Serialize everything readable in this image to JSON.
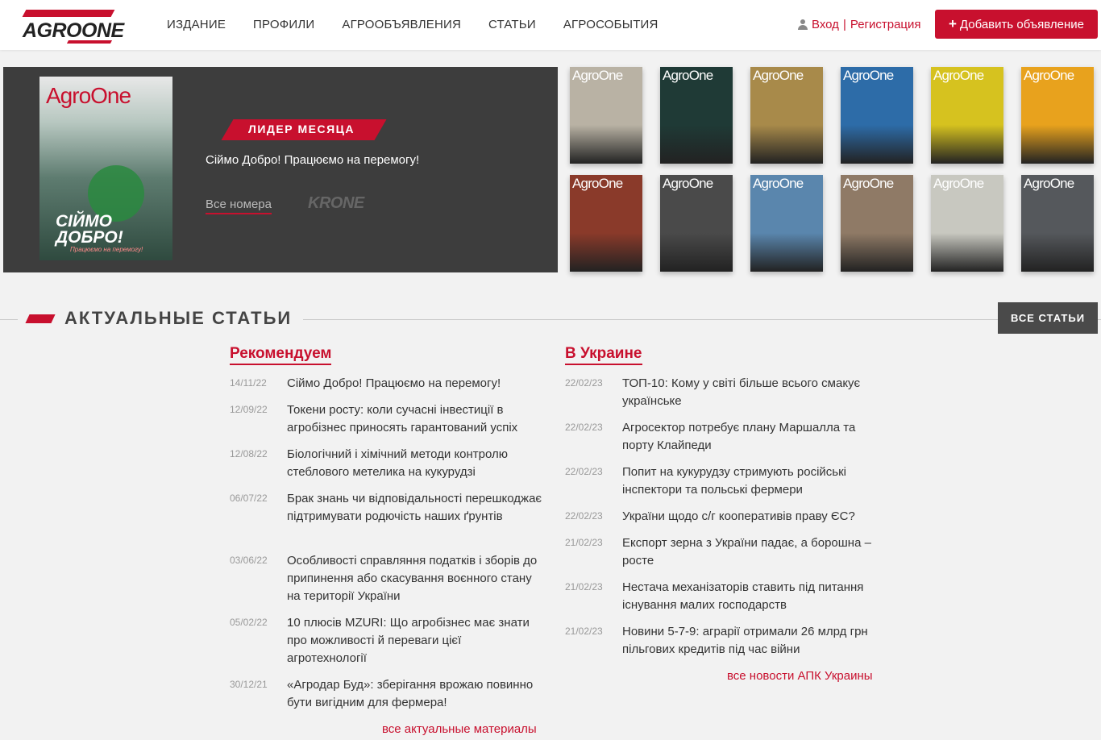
{
  "header": {
    "logo_text_agro": "AGRO",
    "logo_text_one": "ONE",
    "nav": [
      "ИЗДАНИЕ",
      "ПРОФИЛИ",
      "АГРООБЪЯВЛЕНИЯ",
      "СТАТЬИ",
      "АГРОСОБЫТИЯ"
    ],
    "login": "Вход",
    "separator": "|",
    "register": "Регистрация",
    "add_button": "Добавить объявление",
    "add_button_icon": "+"
  },
  "hero": {
    "cover_title": "AgroOne",
    "cover_big": "СІЙМО ДОБРО!",
    "cover_sub": "Працюємо на перемогу!",
    "badge": "ЛИДЕР МЕСЯЦА",
    "subtitle": "Сіймо Добро! Працюємо на перемогу!",
    "all_issues": "Все номера",
    "brand": "KRONE"
  },
  "covers": {
    "title": "AgroOne",
    "colors": [
      "#b9b2a4",
      "#1f3a36",
      "#a88a4a",
      "#2d6ca8",
      "#d6c21f",
      "#e8a21d",
      "#8a3a2a",
      "#4a4a4a",
      "#5a86ad",
      "#8f7a66",
      "#c8c8c0",
      "#55585c"
    ]
  },
  "section": {
    "title": "АКТУАЛЬНЫЕ СТАТЬИ",
    "all_button": "ВСЕ СТАТЬИ"
  },
  "recommended": {
    "heading": "Рекомендуем",
    "items": [
      {
        "date": "14/11/22",
        "title": "Сіймо Добро! Працюємо на перемогу!"
      },
      {
        "date": "12/09/22",
        "title": "Токени росту: коли сучасні інвестиції в агробізнес приносять гарантований успіх"
      },
      {
        "date": "12/08/22",
        "title": "Біологічний і хімічний методи контролю стеблового метелика на кукурудзі"
      },
      {
        "date": "06/07/22",
        "title": "Брак знань чи відповідальності перешкоджає підтримувати родючість наших ґрунтів"
      },
      {
        "date": "03/06/22",
        "title": "Особливості справляння податків і зборів до припинення або скасування воєнного стану на території України"
      },
      {
        "date": "05/02/22",
        "title": "10 плюсів MZURI: Що агробізнес має знати про можливості й переваги цієї агротехнології"
      },
      {
        "date": "30/12/21",
        "title": "«Агродар Буд»: зберігання врожаю повинно бути вигідним для фермера!"
      }
    ],
    "more": "все актуальные материалы"
  },
  "ukraine": {
    "heading": "В Украине",
    "items": [
      {
        "date": "22/02/23",
        "title": "ТОП-10: Кому у світі більше всього смакує українське"
      },
      {
        "date": "22/02/23",
        "title": "Агросектор потребує плану Маршалла та порту Клайпеди"
      },
      {
        "date": "22/02/23",
        "title": "Попит на кукурудзу стримують російські інспектори та польські фермери"
      },
      {
        "date": "22/02/23",
        "title": "України щодо с/г кооперативів праву ЄС?"
      },
      {
        "date": "21/02/23",
        "title": "Експорт зерна з України падає, а борошна – росте"
      },
      {
        "date": "21/02/23",
        "title": "Нестача механізаторів ставить під питання існування малих господарств"
      },
      {
        "date": "21/02/23",
        "title": "Новини 5-7-9: аграрії отримали 26 млрд грн пільгових кредитів під час війни"
      }
    ],
    "more": "все новости АПК Украины"
  }
}
